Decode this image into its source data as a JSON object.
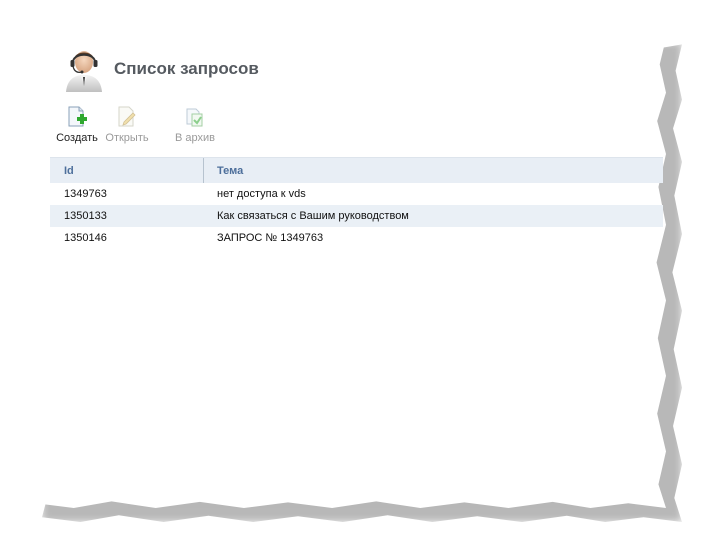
{
  "header": {
    "title": "Список запросов",
    "icon": "support-operator-icon"
  },
  "toolbar": {
    "create_label": "Создать",
    "open_label": "Открыть",
    "archive_label": "В архив"
  },
  "table": {
    "columns": [
      "Id",
      "Тема"
    ],
    "rows": [
      {
        "id": "1349763",
        "subject": "нет доступа к vds"
      },
      {
        "id": "1350133",
        "subject": "Как связаться с Вашим руководством"
      },
      {
        "id": "1350146",
        "subject": "ЗАПРОС № 1349763"
      }
    ]
  },
  "colors": {
    "header_bg": "#e8eef5",
    "header_text": "#4d6f9b",
    "alt_row_bg": "#eaf0f6",
    "title_text": "#555a60"
  }
}
